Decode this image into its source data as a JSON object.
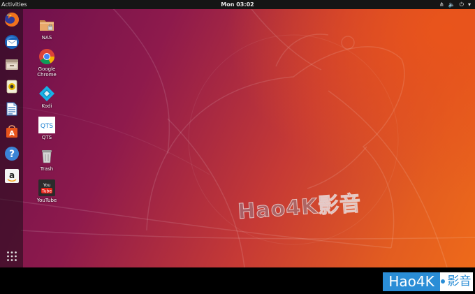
{
  "topbar": {
    "activities_label": "Activities",
    "clock": "Mon 03:02",
    "tray": {
      "network_glyph": "⋔",
      "volume_glyph": "🔈",
      "power_glyph": "⏻",
      "menu_glyph": "▾"
    }
  },
  "dock": {
    "items": [
      {
        "icon": "firefox-icon"
      },
      {
        "icon": "thunderbird-icon"
      },
      {
        "icon": "files-icon"
      },
      {
        "icon": "rhythmbox-icon"
      },
      {
        "icon": "libreoffice-writer-icon"
      },
      {
        "icon": "ubuntu-software-icon"
      },
      {
        "icon": "help-icon"
      },
      {
        "icon": "amazon-icon"
      }
    ],
    "show_apps_icon": "grid-icon"
  },
  "desktop_icons": [
    {
      "label": "NAS",
      "icon": "folder-icon"
    },
    {
      "label": "Google Chrome",
      "icon": "chrome-icon"
    },
    {
      "label": "Kodi",
      "icon": "kodi-icon"
    },
    {
      "label": "QTS",
      "icon": "qts-icon"
    },
    {
      "label": "Trash",
      "icon": "trash-icon"
    },
    {
      "label": "YouTube",
      "icon": "youtube-icon"
    }
  ],
  "watermark": {
    "center_text": "Hao4K影音",
    "logo_latin": "Hao4K",
    "logo_cn": "影音"
  },
  "colors": {
    "topbar": "#151515",
    "logo_blue": "#2a8dd6",
    "wallpaper_start": "#6a0f4d",
    "wallpaper_end": "#ee6a1a"
  }
}
